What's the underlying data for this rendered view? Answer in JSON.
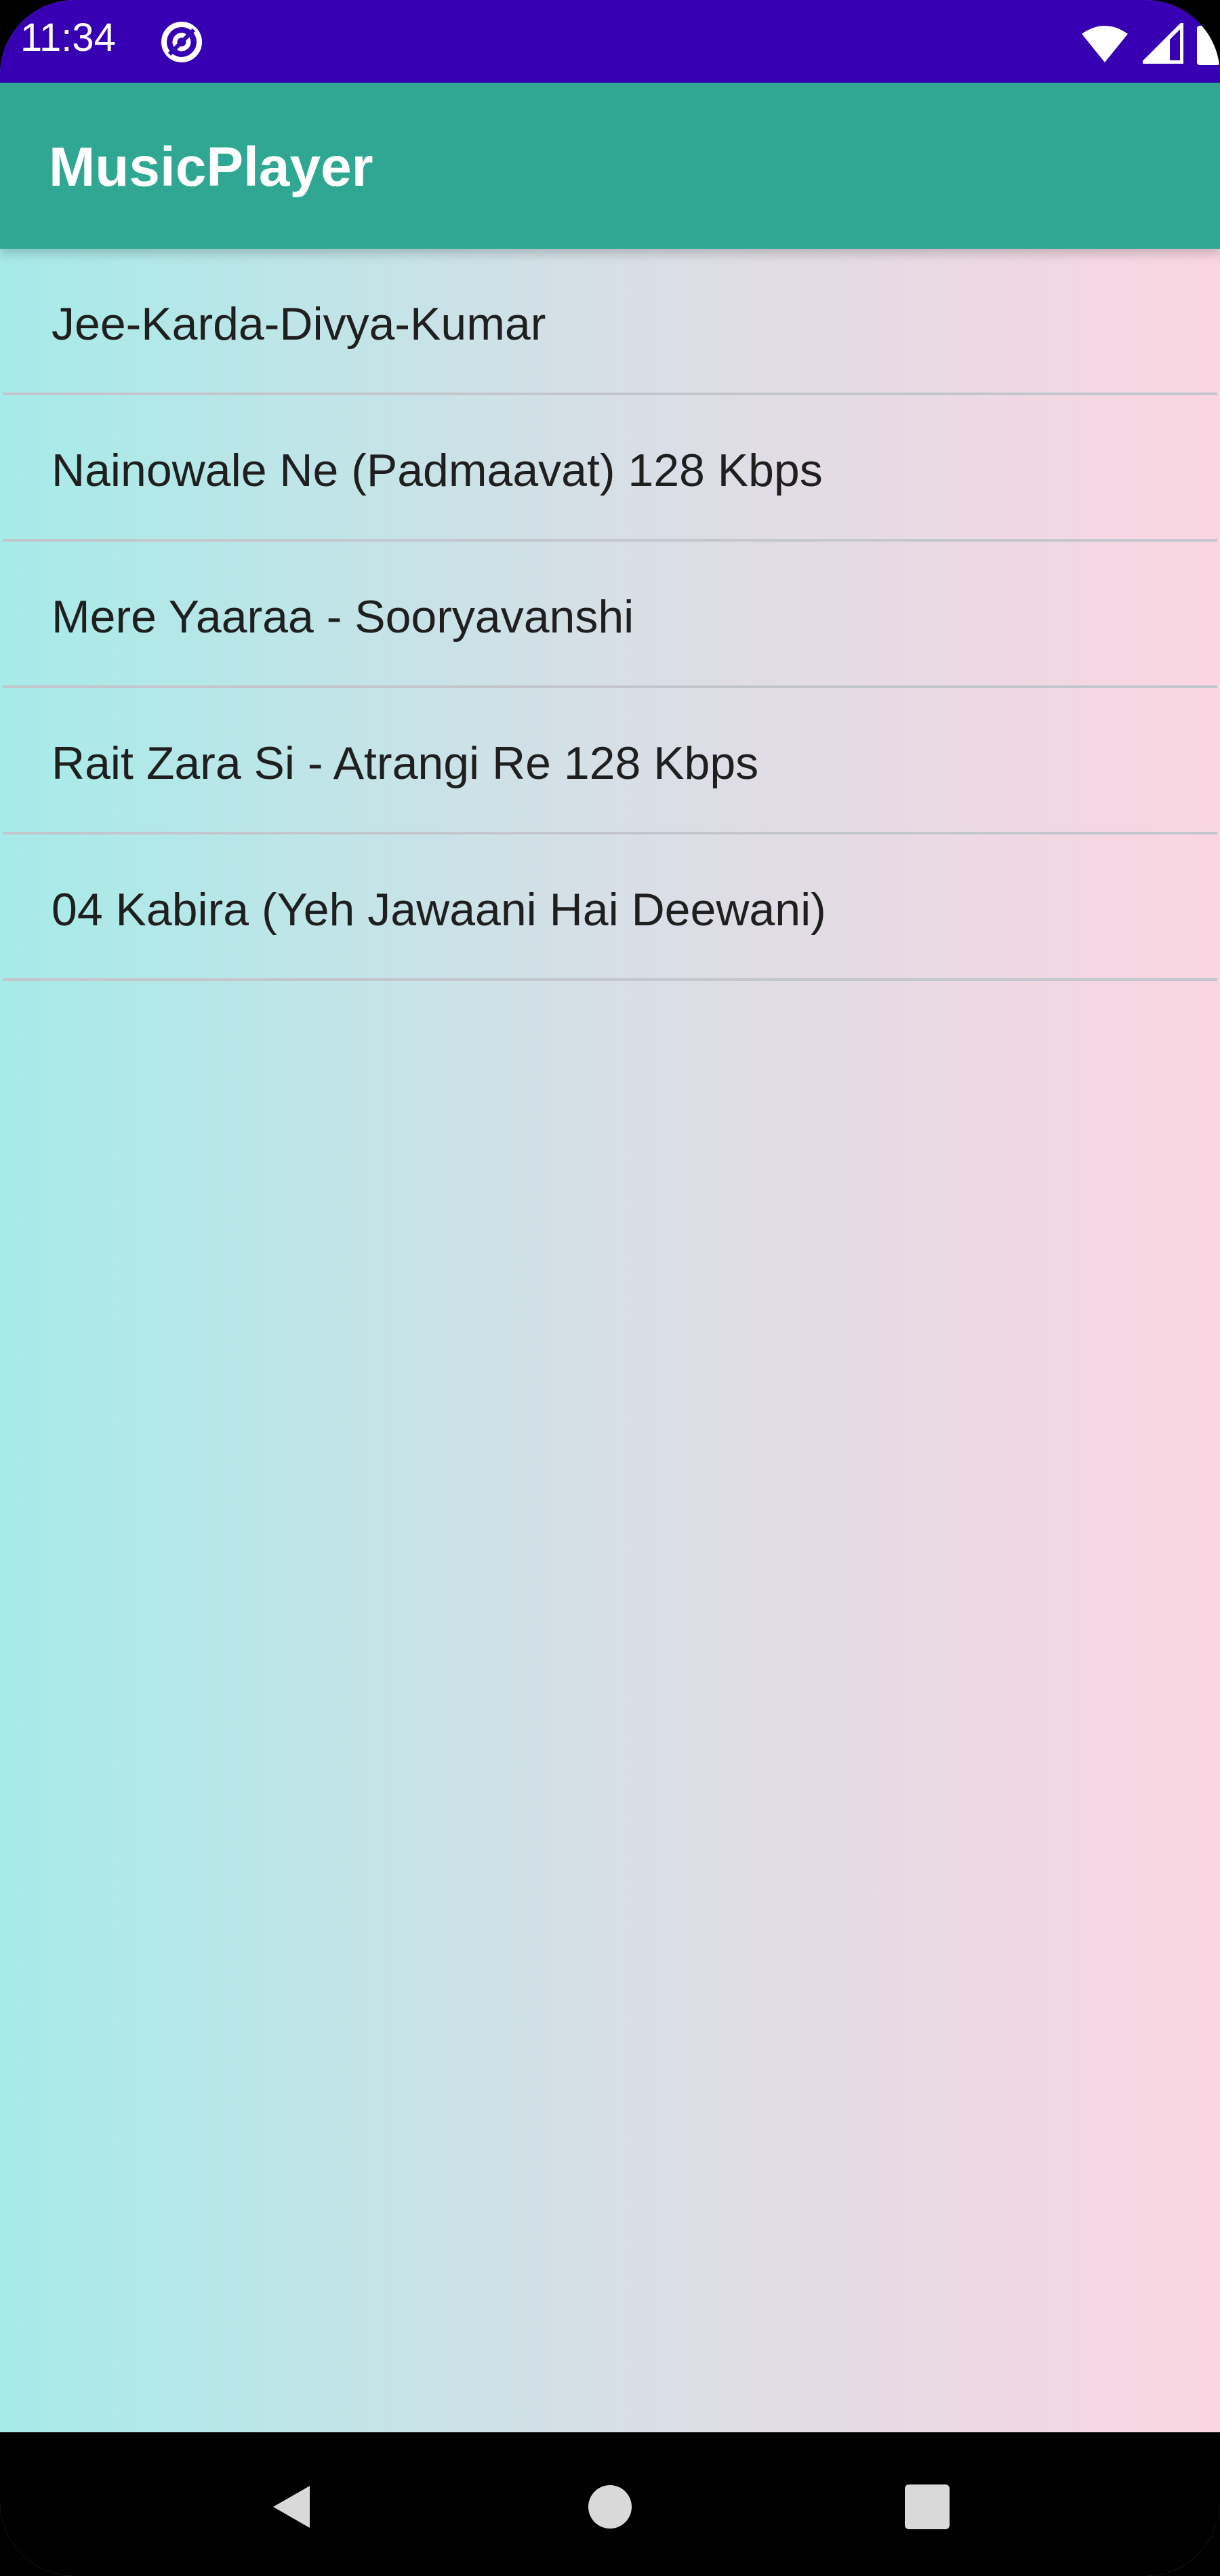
{
  "status_bar": {
    "time": "11:34",
    "icons": [
      "at-sign-icon",
      "wifi-icon",
      "signal-icon",
      "battery-icon"
    ],
    "background_color": "#3700b3"
  },
  "app_bar": {
    "title": "MusicPlayer",
    "background_color": "#30a793"
  },
  "songs": [
    {
      "title": "Jee-Karda-Divya-Kumar"
    },
    {
      "title": "Nainowale Ne (Padmaavat) 128 Kbps"
    },
    {
      "title": "Mere Yaaraa - Sooryavanshi"
    },
    {
      "title": "Rait Zara Si - Atrangi Re 128 Kbps"
    },
    {
      "title": "04 Kabira (Yeh Jawaani Hai Deewani)"
    }
  ],
  "background_gradient": [
    "#a6ebe9",
    "#fbd5e2"
  ],
  "nav_bar": {
    "buttons": [
      "back-icon",
      "home-icon",
      "recents-icon"
    ]
  }
}
